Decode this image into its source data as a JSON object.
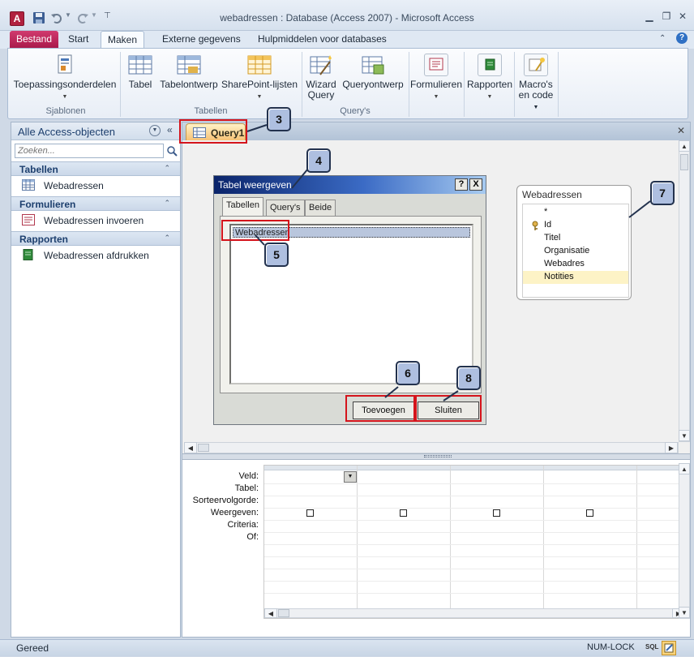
{
  "window": {
    "title": "webadressen : Database (Access 2007)  -  Microsoft Access",
    "app_icon": "A"
  },
  "ribbon_tabs": [
    "Bestand",
    "Start",
    "Maken",
    "Externe gegevens",
    "Hulpmiddelen voor databases"
  ],
  "ribbon": {
    "toepassingsonderdelen": "Toepassingsonderdelen",
    "tabel": "Tabel",
    "tabelontwerp": "Tabelontwerp",
    "sharepoint": "SharePoint-lijsten",
    "wizard_query_1": "Wizard",
    "wizard_query_2": "Query",
    "queryontwerp": "Queryontwerp",
    "formulieren": "Formulieren",
    "rapporten": "Rapporten",
    "macros_1": "Macro's",
    "macros_2": "en code",
    "groups": {
      "sjablonen": "Sjablonen",
      "tabellen": "Tabellen",
      "querys": "Query's"
    }
  },
  "nav": {
    "title": "Alle Access-objecten",
    "search_placeholder": "Zoeken...",
    "sections": [
      {
        "title": "Tabellen",
        "item": "Webadressen"
      },
      {
        "title": "Formulieren",
        "item": "Webadressen invoeren"
      },
      {
        "title": "Rapporten",
        "item": "Webadressen afdrukken"
      }
    ]
  },
  "doc": {
    "tab_label": "Query1"
  },
  "table_box": {
    "title": "Webadressen",
    "fields": [
      "*",
      "Id",
      "Titel",
      "Organisatie",
      "Webadres",
      "Notities"
    ]
  },
  "qbe": {
    "rows": [
      "Veld:",
      "Tabel:",
      "Sorteervolgorde:",
      "Weergeven:",
      "Criteria:",
      "Of:"
    ]
  },
  "dialog": {
    "title": "Tabel weergeven",
    "help": "?",
    "close": "X",
    "tabs": [
      "Tabellen",
      "Query's",
      "Beide"
    ],
    "list_item": "Webadressen",
    "add_button": "Toevoegen",
    "close_button": "Sluiten"
  },
  "callouts": [
    "3",
    "4",
    "5",
    "6",
    "7",
    "8"
  ],
  "status": {
    "text": "Gereed",
    "numlock": "NUM-LOCK",
    "sql": "SQL"
  },
  "colors": {
    "file_tab": "#c21f55",
    "callout_fill": "#aebfe0",
    "highlight_red": "#d4141c",
    "query_tab": "#f6c276"
  }
}
